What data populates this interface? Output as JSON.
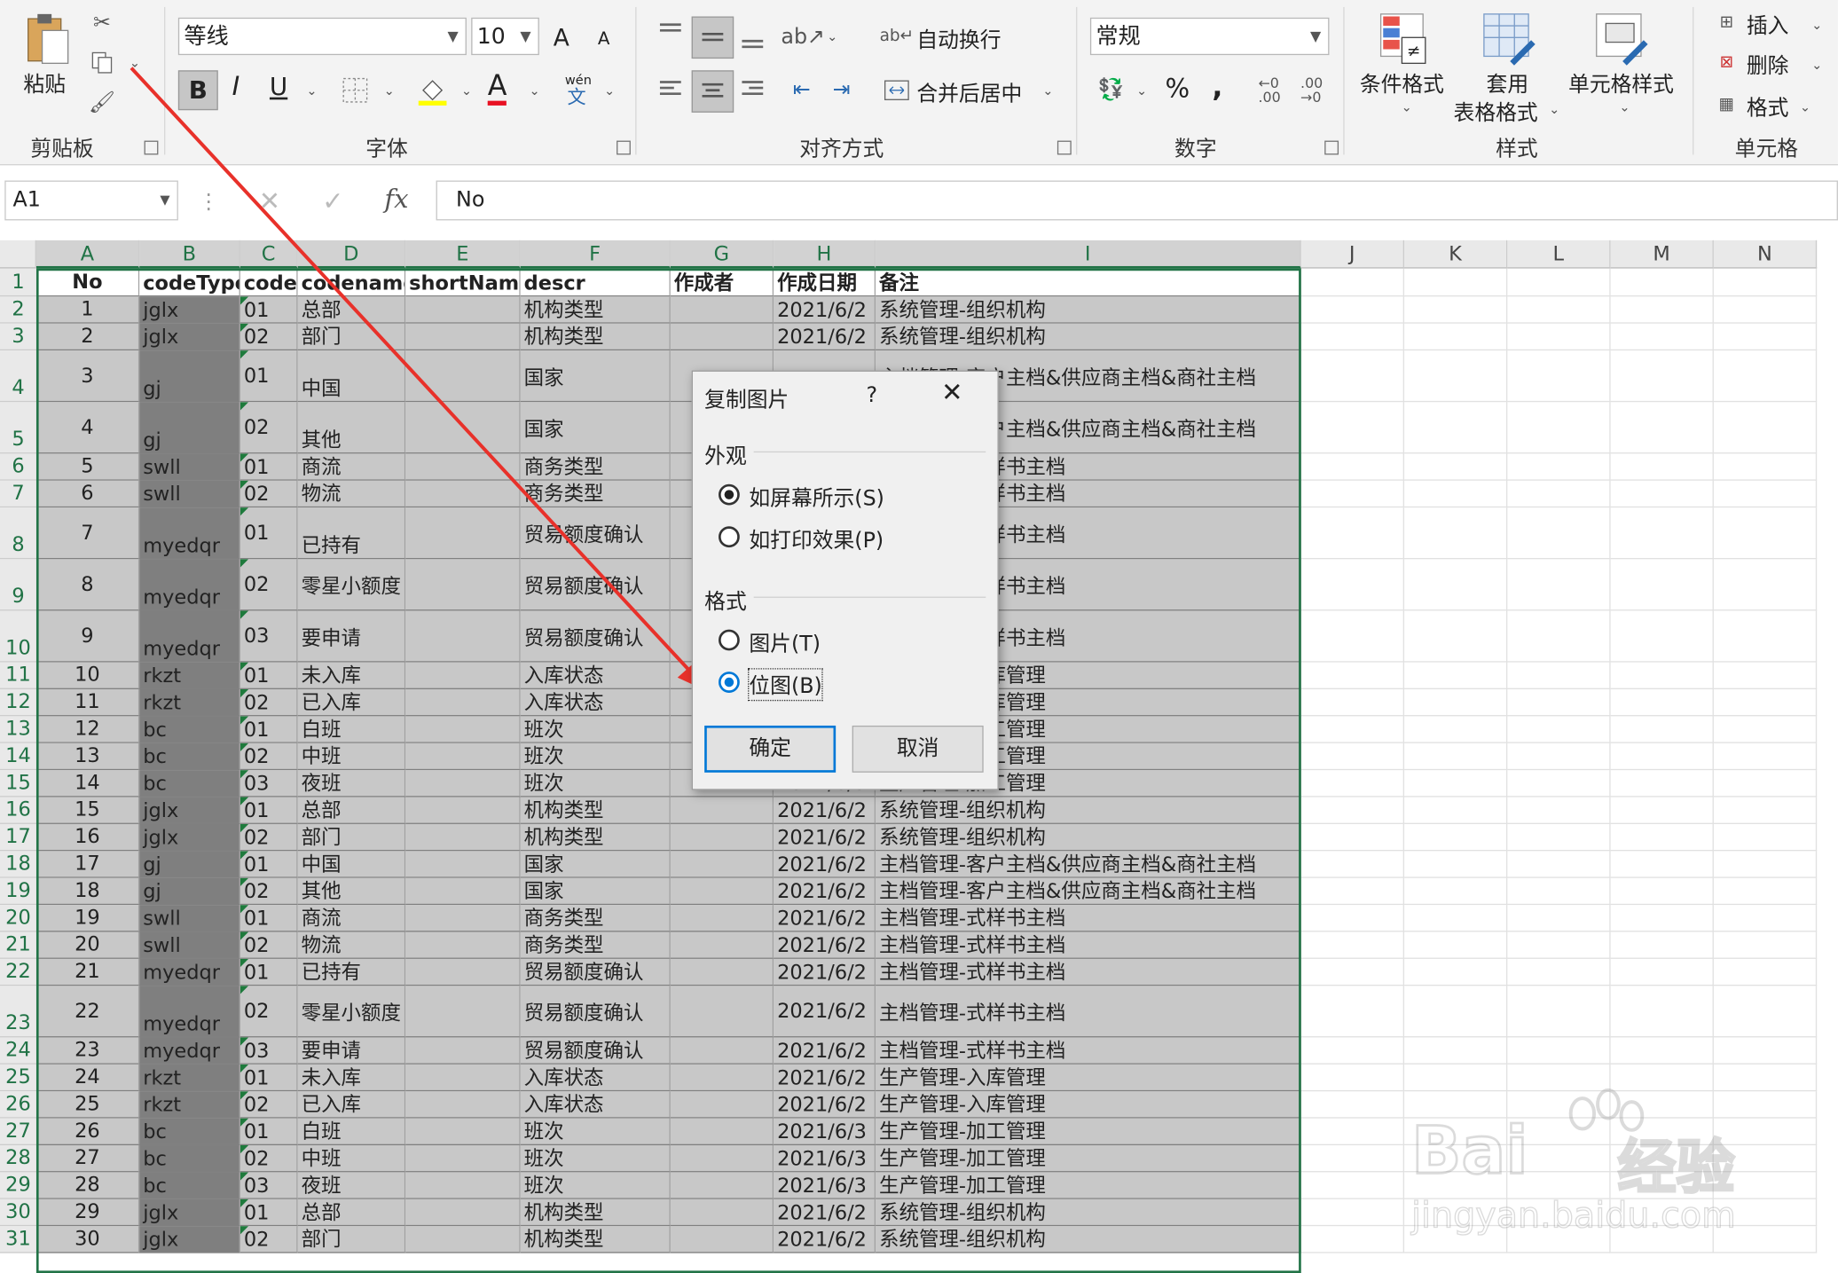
{
  "ribbon": {
    "clipboard": {
      "paste": "粘贴",
      "label": "剪贴板"
    },
    "font": {
      "name": "等线",
      "size": "10",
      "grow": "A",
      "shrink": "A",
      "bold": "B",
      "italic": "I",
      "underline": "U",
      "font_color": "A",
      "phonetic": "wén",
      "label": "字体"
    },
    "alignment": {
      "wrap": "自动换行",
      "merge": "合并后居中",
      "label": "对齐方式"
    },
    "number": {
      "format": "常规",
      "percent": "%",
      "comma": ",",
      "label": "数字"
    },
    "styles": {
      "conditional": "条件格式",
      "table_format_1": "套用",
      "table_format_2": "表格格式",
      "cell_styles": "单元格样式",
      "label": "样式"
    },
    "cells": {
      "insert": "插入",
      "delete": "删除",
      "format": "格式",
      "label": "单元格"
    }
  },
  "formula_bar": {
    "name_box": "A1",
    "fx": "fx",
    "content": "No"
  },
  "columns": [
    "A",
    "B",
    "C",
    "D",
    "E",
    "F",
    "G",
    "H",
    "I",
    "J",
    "K",
    "L",
    "M",
    "N"
  ],
  "table": {
    "headers": [
      "No",
      "codeType",
      "code",
      "codename",
      "shortName",
      "descr",
      "作成者",
      "作成日期",
      "备注"
    ],
    "rows": [
      [
        "1",
        "jglx",
        "01",
        "总部",
        "",
        "机构类型",
        "",
        "2021/6/2",
        "系统管理-组织机构"
      ],
      [
        "2",
        "jglx",
        "02",
        "部门",
        "",
        "机构类型",
        "",
        "2021/6/2",
        "系统管理-组织机构"
      ],
      [
        "3",
        "gj",
        "01",
        "中国",
        "",
        "国家",
        "",
        "",
        "主档管理-客户主档&供应商主档&商社主档"
      ],
      [
        "4",
        "gj",
        "02",
        "其他",
        "",
        "国家",
        "",
        "",
        "主档管理-客户主档&供应商主档&商社主档"
      ],
      [
        "5",
        "swll",
        "01",
        "商流",
        "",
        "商务类型",
        "",
        "",
        "主档管理-式样书主档"
      ],
      [
        "6",
        "swll",
        "02",
        "物流",
        "",
        "商务类型",
        "",
        "",
        "主档管理-式样书主档"
      ],
      [
        "7",
        "myedqr",
        "01",
        "已持有",
        "",
        "贸易额度确认",
        "",
        "",
        "主档管理-式样书主档"
      ],
      [
        "8",
        "myedqr",
        "02",
        "零星小额度",
        "",
        "贸易额度确认",
        "",
        "",
        "主档管理-式样书主档"
      ],
      [
        "9",
        "myedqr",
        "03",
        "要申请",
        "",
        "贸易额度确认",
        "",
        "",
        "主档管理-式样书主档"
      ],
      [
        "10",
        "rkzt",
        "01",
        "未入库",
        "",
        "入库状态",
        "",
        "",
        "生产管理-入库管理"
      ],
      [
        "11",
        "rkzt",
        "02",
        "已入库",
        "",
        "入库状态",
        "",
        "",
        "生产管理-入库管理"
      ],
      [
        "12",
        "bc",
        "01",
        "白班",
        "",
        "班次",
        "",
        "",
        "生产管理-加工管理"
      ],
      [
        "13",
        "bc",
        "02",
        "中班",
        "",
        "班次",
        "",
        "",
        "生产管理-加工管理"
      ],
      [
        "14",
        "bc",
        "03",
        "夜班",
        "",
        "班次",
        "",
        "2021/6/3",
        "生产管理-加工管理"
      ],
      [
        "15",
        "jglx",
        "01",
        "总部",
        "",
        "机构类型",
        "",
        "2021/6/2",
        "系统管理-组织机构"
      ],
      [
        "16",
        "jglx",
        "02",
        "部门",
        "",
        "机构类型",
        "",
        "2021/6/2",
        "系统管理-组织机构"
      ],
      [
        "17",
        "gj",
        "01",
        "中国",
        "",
        "国家",
        "",
        "2021/6/2",
        "主档管理-客户主档&供应商主档&商社主档"
      ],
      [
        "18",
        "gj",
        "02",
        "其他",
        "",
        "国家",
        "",
        "2021/6/2",
        "主档管理-客户主档&供应商主档&商社主档"
      ],
      [
        "19",
        "swll",
        "01",
        "商流",
        "",
        "商务类型",
        "",
        "2021/6/2",
        "主档管理-式样书主档"
      ],
      [
        "20",
        "swll",
        "02",
        "物流",
        "",
        "商务类型",
        "",
        "2021/6/2",
        "主档管理-式样书主档"
      ],
      [
        "21",
        "myedqr",
        "01",
        "已持有",
        "",
        "贸易额度确认",
        "",
        "2021/6/2",
        "主档管理-式样书主档"
      ],
      [
        "22",
        "myedqr",
        "02",
        "零星小额度",
        "",
        "贸易额度确认",
        "",
        "2021/6/2",
        "主档管理-式样书主档"
      ],
      [
        "23",
        "myedqr",
        "03",
        "要申请",
        "",
        "贸易额度确认",
        "",
        "2021/6/2",
        "主档管理-式样书主档"
      ],
      [
        "24",
        "rkzt",
        "01",
        "未入库",
        "",
        "入库状态",
        "",
        "2021/6/2",
        "生产管理-入库管理"
      ],
      [
        "25",
        "rkzt",
        "02",
        "已入库",
        "",
        "入库状态",
        "",
        "2021/6/2",
        "生产管理-入库管理"
      ],
      [
        "26",
        "bc",
        "01",
        "白班",
        "",
        "班次",
        "",
        "2021/6/3",
        "生产管理-加工管理"
      ],
      [
        "27",
        "bc",
        "02",
        "中班",
        "",
        "班次",
        "",
        "2021/6/3",
        "生产管理-加工管理"
      ],
      [
        "28",
        "bc",
        "03",
        "夜班",
        "",
        "班次",
        "",
        "2021/6/3",
        "生产管理-加工管理"
      ],
      [
        "29",
        "jglx",
        "01",
        "总部",
        "",
        "机构类型",
        "",
        "2021/6/2",
        "系统管理-组织机构"
      ],
      [
        "30",
        "jglx",
        "02",
        "部门",
        "",
        "机构类型",
        "",
        "2021/6/2",
        "系统管理-组织机构"
      ]
    ]
  },
  "dialog": {
    "title": "复制图片",
    "help": "?",
    "close": "✕",
    "appearance_label": "外观",
    "as_shown": "如屏幕所示(S)",
    "as_printed": "如打印效果(P)",
    "format_label": "格式",
    "picture": "图片(T)",
    "bitmap": "位图(B)",
    "ok": "确定",
    "cancel": "取消"
  },
  "watermark": {
    "brand": "Bai",
    "product": "经验",
    "url": "jingyan.baidu.com"
  },
  "colors": {
    "accent_green": "#217346",
    "selection_gray": "#c8c8c8",
    "column_b_gray": "#7f7f7f",
    "arrow_red": "#e8312a",
    "dialog_blue": "#0078d7"
  }
}
